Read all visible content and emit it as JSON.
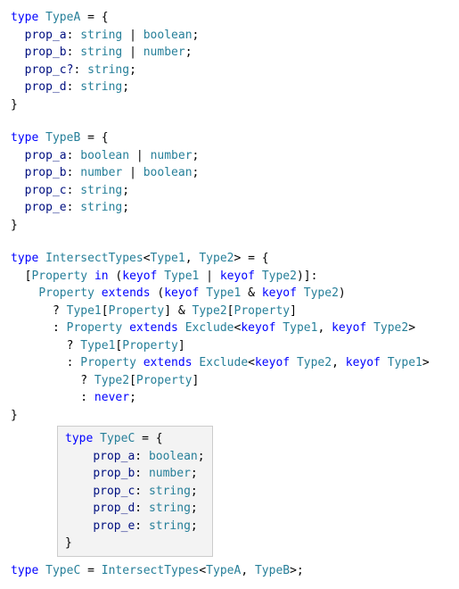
{
  "typeA": {
    "decl": "type",
    "name": "TypeA",
    "props": {
      "a": {
        "name": "prop_a",
        "type1": "string",
        "type2": "boolean"
      },
      "b": {
        "name": "prop_b",
        "type1": "string",
        "type2": "number"
      },
      "c": {
        "name": "prop_c?",
        "type1": "string"
      },
      "d": {
        "name": "prop_d",
        "type1": "string"
      }
    }
  },
  "typeB": {
    "decl": "type",
    "name": "TypeB",
    "props": {
      "a": {
        "name": "prop_a",
        "type1": "boolean",
        "type2": "number"
      },
      "b": {
        "name": "prop_b",
        "type1": "number",
        "type2": "boolean"
      },
      "c": {
        "name": "prop_c",
        "type1": "string"
      },
      "e": {
        "name": "prop_e",
        "type1": "string"
      }
    }
  },
  "intersect": {
    "decl": "type",
    "name": "IntersectTypes",
    "param1": "Type1",
    "param2": "Type2",
    "property": "Property",
    "in": "in",
    "keyof": "keyof",
    "extends": "extends",
    "exclude": "Exclude",
    "never": "never"
  },
  "tooltip": {
    "decl": "type",
    "name": "TypeC",
    "props": {
      "a": {
        "name": "prop_a",
        "type1": "boolean"
      },
      "b": {
        "name": "prop_b",
        "type1": "number"
      },
      "c": {
        "name": "prop_c",
        "type1": "string"
      },
      "d": {
        "name": "prop_d",
        "type1": "string"
      },
      "e": {
        "name": "prop_e",
        "type1": "string"
      }
    }
  },
  "typeC": {
    "decl": "type",
    "name": "TypeC",
    "ref": "IntersectTypes",
    "arg1": "TypeA",
    "arg2": "TypeB"
  }
}
